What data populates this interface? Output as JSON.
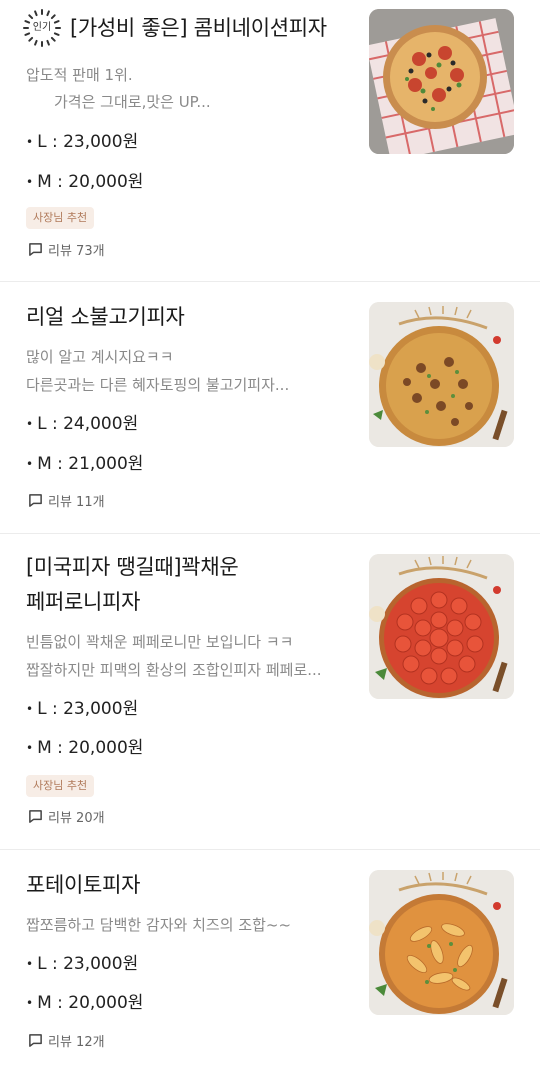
{
  "items": [
    {
      "title": "[가성비 좋은] 콤비네이션피자",
      "popular_badge": "인기",
      "desc": [
        "압도적 판매 1위.",
        "가격은 그대로,맛은 UP..."
      ],
      "prices": [
        "L : 23,000원",
        "M : 20,000원"
      ],
      "owner_badge": "사장님 추천",
      "review": "리뷰 73개",
      "image": "combination-pizza"
    },
    {
      "title": "리얼 소불고기피자",
      "desc": [
        "많이 알고 계시지요ㅋㅋ",
        "다른곳과는 다른 혜자토핑의 불고기피자..."
      ],
      "prices": [
        "L : 24,000원",
        "M : 21,000원"
      ],
      "review": "리뷰 11개",
      "image": "bulgogi-pizza"
    },
    {
      "title_lines": [
        "[미국피자  땡길때]꽉채운",
        "페퍼로니피자"
      ],
      "desc": [
        "빈틈없이 꽉채운 페페로니만 보입니다 ㅋㅋ",
        "짭잘하지만 피맥의 환상의 조합인피자 페페로..."
      ],
      "prices": [
        "L : 23,000원",
        "M : 20,000원"
      ],
      "owner_badge": "사장님 추천",
      "review": "리뷰 20개",
      "image": "pepperoni-pizza"
    },
    {
      "title": "포테이토피자",
      "desc": [
        "짭쪼름하고 담백한 감자와 치즈의 조합~~"
      ],
      "prices": [
        "L : 23,000원",
        "M : 20,000원"
      ],
      "review": "리뷰 12개",
      "image": "potato-pizza"
    }
  ]
}
